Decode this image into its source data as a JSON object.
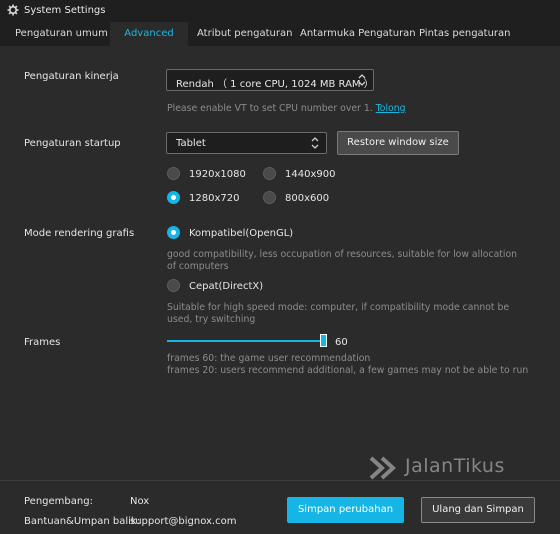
{
  "window": {
    "title": "System Settings",
    "icon": "gear-icon"
  },
  "tabs": [
    {
      "label": "Pengaturan umum",
      "active": false
    },
    {
      "label": "Advanced",
      "active": true
    },
    {
      "label": "Atribut pengaturan",
      "active": false
    },
    {
      "label": "Antarmuka Pengaturan",
      "active": false
    },
    {
      "label": "Pintas pengaturan",
      "active": false
    }
  ],
  "performance": {
    "label": "Pengaturan kinerja",
    "selected": "Rendah （ 1 core CPU, 1024 MB RAM ）",
    "hint": "Please enable VT to set CPU number over 1.",
    "hint_link": "Tolong"
  },
  "startup": {
    "label": "Pengaturan startup",
    "selected": "Tablet",
    "restore_button": "Restore window size",
    "resolutions": [
      {
        "label": "1920x1080",
        "selected": false
      },
      {
        "label": "1440x900",
        "selected": false
      },
      {
        "label": "1280x720",
        "selected": true
      },
      {
        "label": "800x600",
        "selected": false
      }
    ]
  },
  "rendering": {
    "label": "Mode rendering grafis",
    "options": [
      {
        "label": "Kompatibel(OpenGL)",
        "selected": true,
        "description": "good compatibility, less occupation of resources, suitable for low allocation of computers"
      },
      {
        "label": "Cepat(DirectX)",
        "selected": false,
        "description": "Suitable for high speed mode: computer, if compatibility mode cannot be used, try switching"
      }
    ]
  },
  "frames": {
    "label": "Frames",
    "value": "60",
    "level": 1.0,
    "hint_line1": "frames 60: the game user recommendation",
    "hint_line2": "frames 20: users recommend additional, a few games may not be able to run"
  },
  "watermark": {
    "text": "JalanTikus"
  },
  "footer": {
    "developer_label": "Pengembang:",
    "developer_value": "Nox",
    "support_label": "Bantuan&Umpan balik:",
    "support_value": "support@bignox.com",
    "save_button": "Simpan perubahan",
    "restart_button": "Ulang dan Simpan"
  },
  "colors": {
    "accent": "#15b5e6",
    "background": "#2b2b2b",
    "bar": "#1f1f1f"
  }
}
